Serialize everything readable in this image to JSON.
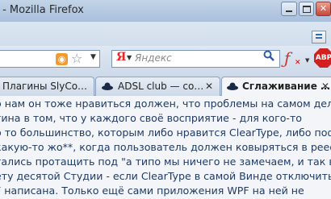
{
  "window": {
    "title": "o - Mozilla Firefox",
    "minimize_label": "",
    "maximize_label": "",
    "close_label": "✕"
  },
  "toolbar": {
    "rss_icon": "rss-feed-icon",
    "bookmark_star_icon": "bookmark-star-icon",
    "url_dropdown": "▼",
    "search_engine_logo": "Я",
    "search_engine_dropdown": "▼",
    "search_placeholder": "Яндекс",
    "search_go_icon": "magnifier-icon",
    "flash_addon_label": "ƒ",
    "flash_addon_badge": "✕",
    "flash_dropdown": "▼",
    "adblock_label": "ABP"
  },
  "tabs": [
    {
      "label": "Плагины SlyCo…",
      "close": "✕",
      "active": false
    },
    {
      "label": "ADSL club — co…",
      "close": "✕",
      "active": false
    },
    {
      "label": "Сглаживание …",
      "close": "✕",
      "active": true
    }
  ],
  "content": {
    "lines": [
      "о нам он тоже нравиться должен, что проблемы на самом деле",
      "тина в том, что у каждого своё восприятие - для кого-то",
      "о то большинство, которым либо нравится ClearType, либо пофиг",
      "какую-то жо**, когда пользователь должен ковыряться в реестре",
      "тались протащить под \"а типо мы ничего не замечаем, и так всё",
      "ету десятой Студии - если ClearType в самой Винде отключить",
      "F написана. Только ещё сами приложения WPF на ней не"
    ]
  },
  "colors": {
    "text": "#1f3b63",
    "content_bg": "#f4f5f8",
    "adblock": "#d21f1f",
    "rss": "#f29a2e"
  }
}
